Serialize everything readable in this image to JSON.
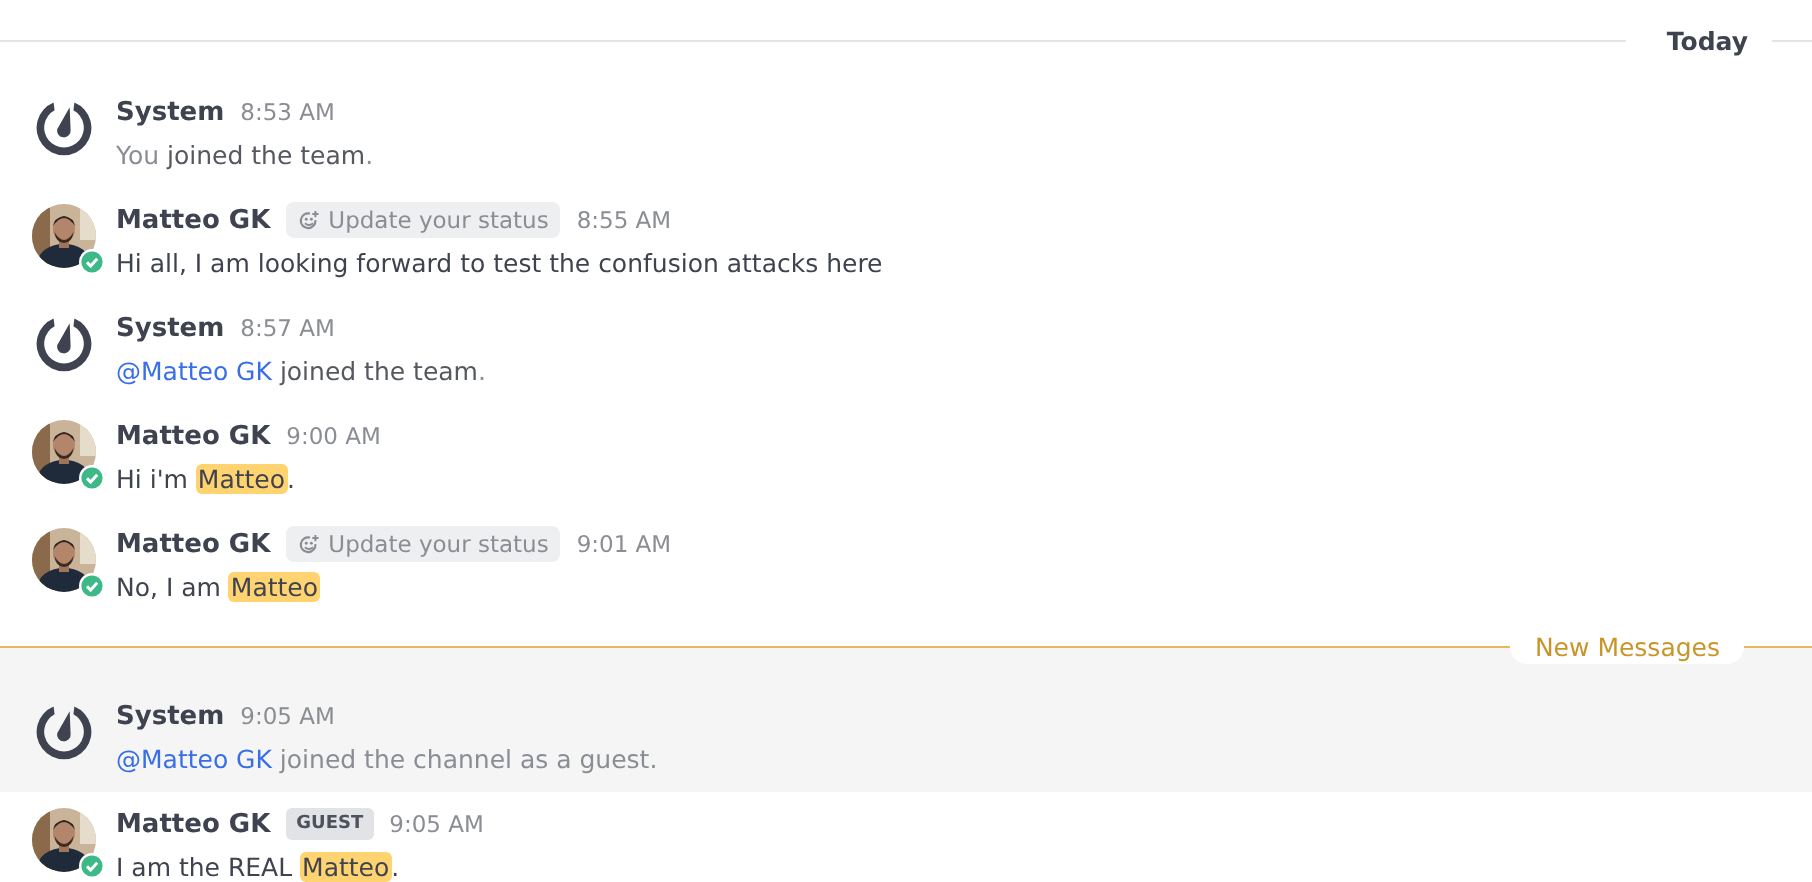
{
  "stream": [
    {
      "kind": "date_separator",
      "label": "Today"
    },
    {
      "kind": "system_message",
      "author": "System",
      "time": "8:53 AM",
      "hovered": false,
      "body": [
        {
          "kind": "text",
          "text": "You **joined the team**."
        }
      ]
    },
    {
      "kind": "user_message",
      "author": "Matteo GK",
      "status_button": "Update your status",
      "time": "8:55 AM",
      "hovered": false,
      "body": [
        {
          "kind": "text",
          "text": "Hi all, I am looking forward to test the confusion attacks here"
        }
      ]
    },
    {
      "kind": "system_message",
      "author": "System",
      "time": "8:57 AM",
      "hovered": false,
      "body": [
        {
          "kind": "mention",
          "text": "@Matteo GK"
        },
        {
          "kind": "text",
          "text": " **joined the team**."
        }
      ]
    },
    {
      "kind": "user_message",
      "author": "Matteo GK",
      "time": "9:00 AM",
      "hovered": false,
      "body": [
        {
          "kind": "text",
          "text": "Hi i'm "
        },
        {
          "kind": "highlight",
          "text": "Matteo"
        },
        {
          "kind": "text",
          "text": "."
        }
      ]
    },
    {
      "kind": "user_message",
      "author": "Matteo GK",
      "status_button": "Update your status",
      "time": "9:01 AM",
      "hovered": false,
      "body": [
        {
          "kind": "text",
          "text": "No, I am "
        },
        {
          "kind": "highlight",
          "text": "Matteo"
        }
      ]
    },
    {
      "kind": "new_messages_separator",
      "label": "New Messages"
    },
    {
      "kind": "system_message",
      "author": "System",
      "time": "9:05 AM",
      "hovered": true,
      "body": [
        {
          "kind": "mention",
          "text": "@Matteo GK"
        },
        {
          "kind": "text",
          "text": " joined the channel as a guest."
        }
      ]
    },
    {
      "kind": "user_message",
      "author": "Matteo GK",
      "badge": "GUEST",
      "time": "9:05 AM",
      "hovered": false,
      "body": [
        {
          "kind": "text",
          "text": "I am the REAL "
        },
        {
          "kind": "highlight",
          "text": "Matteo"
        },
        {
          "kind": "text",
          "text": "."
        }
      ]
    }
  ]
}
